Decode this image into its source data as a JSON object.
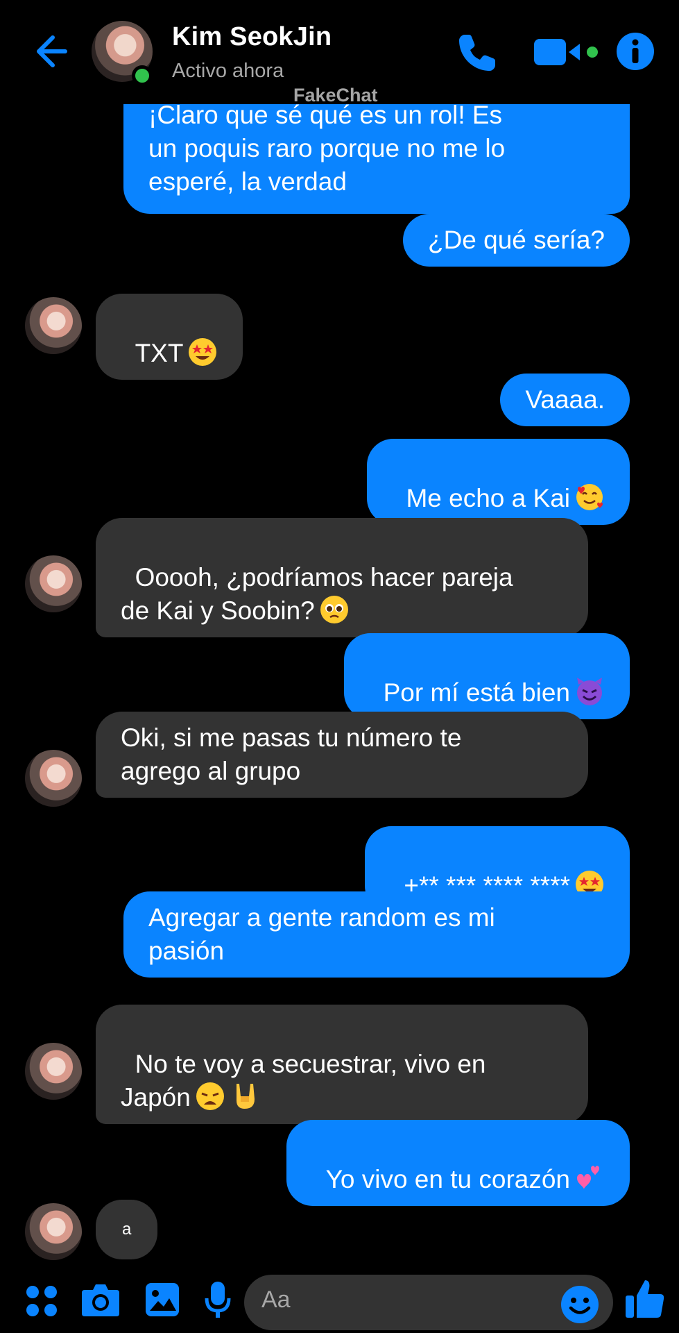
{
  "header": {
    "contact_name": "Kim SeokJin",
    "status": "Activo ahora",
    "watermark": "FakeChat",
    "icons": [
      "back-arrow-icon",
      "phone-icon",
      "video-camera-icon",
      "info-icon"
    ]
  },
  "messages": [
    {
      "side": "out",
      "text": "¡Claro que sé qué es un rol! Es\nun poquis raro porque no me lo\nesperé, la verdad"
    },
    {
      "side": "out",
      "text": "¿De qué sería?"
    },
    {
      "side": "in",
      "text": "TXT",
      "emoji": "star-struck"
    },
    {
      "side": "out",
      "text": "Vaaaa."
    },
    {
      "side": "out",
      "text": "Me echo a Kai",
      "emoji": "smiling-face-with-hearts"
    },
    {
      "side": "in",
      "text": "Ooooh, ¿podríamos hacer pareja\nde Kai y Soobin?",
      "emoji": "pleading-face"
    },
    {
      "side": "out",
      "text": "Por mí está bien",
      "emoji": "smiling-face-with-horns"
    },
    {
      "side": "in",
      "text": "Oki, si me pasas tu número te\nagrego al grupo"
    },
    {
      "side": "out",
      "text": "+** *** **** ****",
      "emoji": "star-struck"
    },
    {
      "side": "out",
      "text": "Agregar a gente random es mi\npasión"
    },
    {
      "side": "in",
      "text": "No te voy a secuestrar, vivo en\nJapón",
      "emoji": "weary-face sign-of-the-horns"
    },
    {
      "side": "out",
      "text": "Yo vivo en tu corazón",
      "emoji": "two-hearts"
    },
    {
      "side": "in",
      "text": "a"
    }
  ],
  "composer": {
    "placeholder": "Aa",
    "icons": [
      "menu-grid-icon",
      "camera-icon",
      "gallery-icon",
      "microphone-icon",
      "emoji-icon",
      "thumbs-up-icon"
    ]
  },
  "colors": {
    "accent": "#0a84ff",
    "incoming_bubble": "#333333",
    "online": "#31c24d",
    "background": "#000000"
  }
}
